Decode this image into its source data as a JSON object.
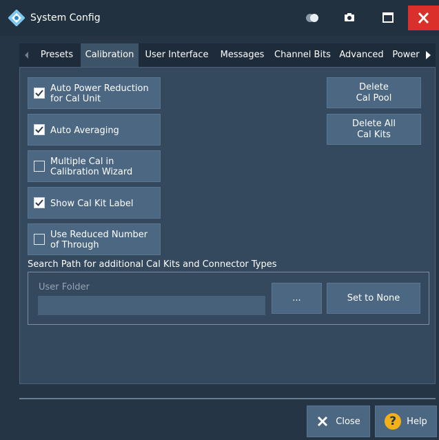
{
  "window": {
    "title": "System Config"
  },
  "tabs": [
    {
      "label": "Presets",
      "active": false
    },
    {
      "label": "Calibration",
      "active": true
    },
    {
      "label": "User Interface",
      "active": false
    },
    {
      "label": "Messages",
      "active": false
    },
    {
      "label": "Channel Bits",
      "active": false
    },
    {
      "label": "Advanced",
      "active": false
    },
    {
      "label": "Power",
      "active": false
    }
  ],
  "checkboxes": [
    {
      "label": "Auto Power Reduction\nfor Cal Unit",
      "checked": true
    },
    {
      "label": "Auto Averaging",
      "checked": true
    },
    {
      "label": "Multiple Cal in\nCalibration Wizard",
      "checked": false
    },
    {
      "label": "Show Cal Kit Label",
      "checked": true
    },
    {
      "label": "Use Reduced Number\nof Through",
      "checked": false
    }
  ],
  "buttons": {
    "delete_cal_pool": "Delete\nCal Pool",
    "delete_all_cal_kits": "Delete All\nCal Kits",
    "browse": "...",
    "set_to_none": "Set to None",
    "close": "Close",
    "help": "Help"
  },
  "search_path": {
    "label": "Search Path for additional Cal Kits and Connector Types",
    "folder_label": "User Folder",
    "folder_value": ""
  },
  "colors": {
    "close_red": "#d9302c",
    "help_yellow": "#f2b11a",
    "background": "#253545"
  }
}
